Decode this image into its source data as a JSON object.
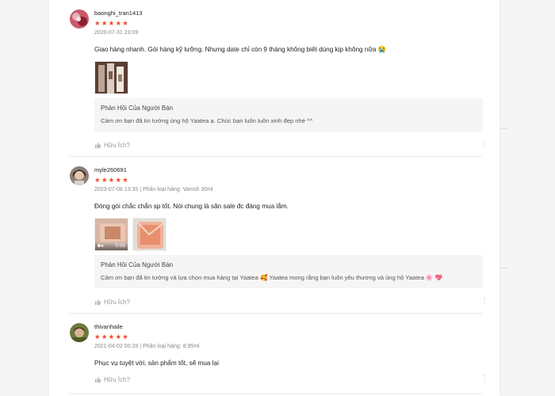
{
  "helpful_label": "Hữu Ích?",
  "reply_title": "Phản Hồi Của Người Bán",
  "reviews": [
    {
      "username": "baonghi_tran1413",
      "stars": "★★★★★",
      "meta": "2020-07-31 23:09",
      "comment": "Giao hàng nhanh. Gói hàng kỹ lưỡng. Nhưng date chỉ còn 9 tháng không biết dùng kịp không nữa 😭",
      "reply": "Cảm ơn bạn đã tin tưởng ủng hộ Yaatea ạ. Chúc bạn luôn luôn xinh đẹp nhé ^^"
    },
    {
      "username": "myle260691",
      "stars": "★★★★★",
      "meta": "2023-07-08 13:35 | Phân loại hàng: Vanish 30ml",
      "comment": "Đóng gói chắc chắn sp tốt. Nói chung là săn sale đc đáng mua lắm.",
      "video_duration": "0:05",
      "reply": "Cảm ơn bạn đã tin tưởng và lựa chọn mua hàng tại Yaatea 🥰 Yaatea mong rằng bạn luôn yêu thương và ủng hộ Yaatea 🌸 💖"
    },
    {
      "username": "thivanhaile",
      "stars": "★★★★★",
      "meta": "2021-04-02 00:28 | Phân loại hàng: 8,95ml",
      "comment": "Phục vụ tuyệt vời, sản phẩm tốt, sẽ mua lại"
    }
  ],
  "icons": {
    "thumb": "thumbs-up-icon",
    "more": "more-vertical-icon",
    "video": "video-camera-icon"
  },
  "colors": {
    "accent": "#ee4d2d",
    "muted": "#999999",
    "reply_bg": "#f5f5f5"
  }
}
